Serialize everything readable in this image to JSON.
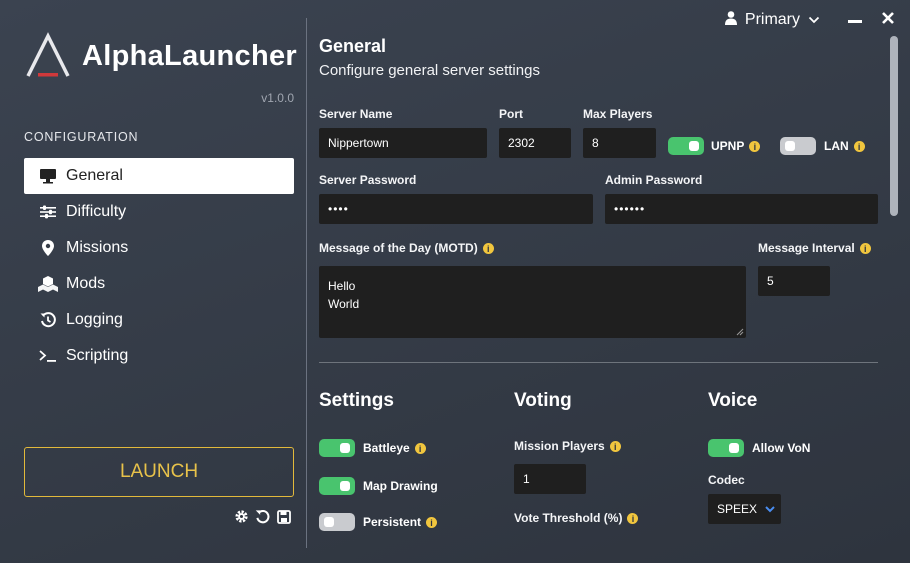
{
  "app": {
    "name": "AlphaLauncher",
    "version": "v1.0.0"
  },
  "window": {
    "profile": "Primary"
  },
  "sidebar": {
    "heading": "CONFIGURATION",
    "items": [
      {
        "label": "General",
        "icon": "monitor-icon",
        "active": true
      },
      {
        "label": "Difficulty",
        "icon": "sliders-icon"
      },
      {
        "label": "Missions",
        "icon": "map-pin-icon"
      },
      {
        "label": "Mods",
        "icon": "cubes-icon"
      },
      {
        "label": "Logging",
        "icon": "history-icon"
      },
      {
        "label": "Scripting",
        "icon": "terminal-icon"
      }
    ],
    "launch_label": "LAUNCH",
    "bottom_icons": [
      "gear-icon",
      "undo-icon",
      "save-icon"
    ]
  },
  "general": {
    "title": "General",
    "subtitle": "Configure general server settings",
    "server_name": {
      "label": "Server Name",
      "value": "Nippertown"
    },
    "port": {
      "label": "Port",
      "value": "2302"
    },
    "max_players": {
      "label": "Max Players",
      "value": "8"
    },
    "upnp": {
      "label": "UPNP",
      "on": true
    },
    "lan": {
      "label": "LAN",
      "on": false
    },
    "server_password": {
      "label": "Server Password",
      "value": "••••"
    },
    "admin_password": {
      "label": "Admin Password",
      "value": "••••••"
    },
    "motd": {
      "label": "Message of the Day (MOTD)",
      "line1": "Hello",
      "line2": "World"
    },
    "message_interval": {
      "label": "Message Interval",
      "value": "5"
    }
  },
  "settings": {
    "title": "Settings",
    "battleye": {
      "label": "Battleye",
      "on": true
    },
    "map_drawing": {
      "label": "Map Drawing",
      "on": true
    },
    "persistent": {
      "label": "Persistent",
      "on": false
    }
  },
  "voting": {
    "title": "Voting",
    "mission_players": {
      "label": "Mission Players",
      "value": "1"
    },
    "vote_threshold": {
      "label": "Vote Threshold (%)"
    }
  },
  "voice": {
    "title": "Voice",
    "allow_von": {
      "label": "Allow VoN",
      "on": true
    },
    "codec": {
      "label": "Codec",
      "value": "SPEEX"
    }
  },
  "colors": {
    "accent": "#e2b93b",
    "toggle_on": "#49c46e",
    "toggle_off": "#c9cbcf",
    "info": "#f1c63e"
  }
}
